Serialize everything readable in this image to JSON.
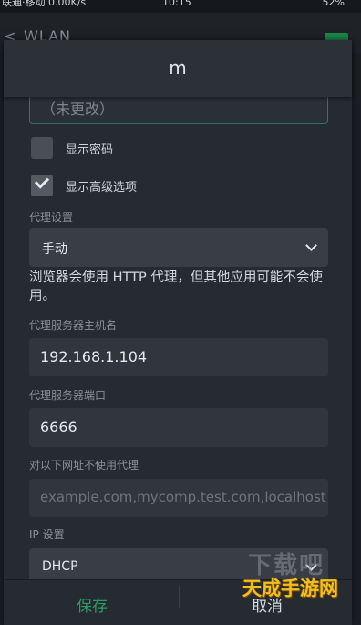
{
  "status_bar": {
    "left": "联通·移动 0.00K/s",
    "time": "10:15",
    "battery": "52%"
  },
  "app_bar": {
    "title": "WLAN"
  },
  "dialog": {
    "title": "m",
    "password_value": "（未更改）",
    "show_password_label": "显示密码",
    "show_advanced_label": "显示高级选项",
    "proxy_section_label": "代理设置",
    "proxy_value": "手动",
    "proxy_note": "浏览器会使用 HTTP 代理，但其他应用可能不会使用。",
    "hostname_label": "代理服务器主机名",
    "hostname_value": "192.168.1.104",
    "port_label": "代理服务器端口",
    "port_value": "6666",
    "bypass_label": "对以下网址不使用代理",
    "bypass_placeholder": "example.com,mycomp.test.com,localhost",
    "ip_label": "IP 设置",
    "ip_value": "DHCP"
  },
  "buttons": {
    "save": "保存",
    "cancel": "取消"
  },
  "watermark": {
    "top": "下载吧",
    "bottom": "天成手游网"
  },
  "colors": {
    "accent": "#2a9d63",
    "dialog_bg": "#262a31",
    "field_bg": "#31353d"
  }
}
